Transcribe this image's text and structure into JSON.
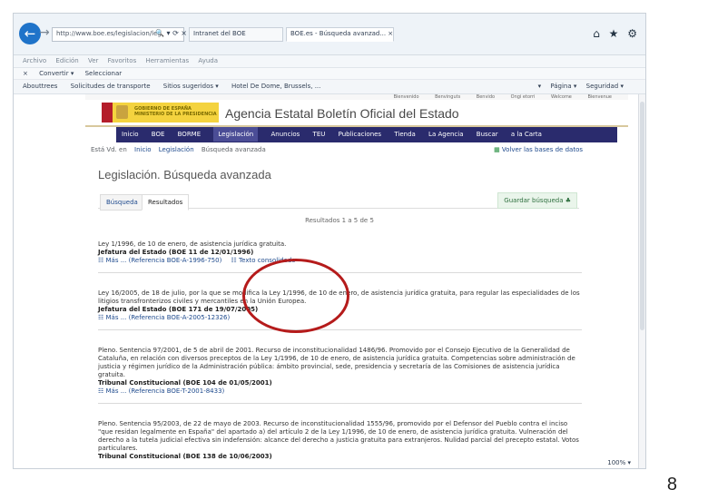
{
  "page": {
    "number": "8"
  },
  "browser": {
    "address": "http://www.boe.es/legislacion/leg",
    "address_icons": "🔍 ▾ ⟳ ×",
    "tabs": [
      {
        "label": "Intranet del BOE"
      },
      {
        "label": "BOE.es - Búsqueda avanzad... ×"
      }
    ],
    "menu": [
      "Archivo",
      "Edición",
      "Ver",
      "Favoritos",
      "Herramientas",
      "Ayuda"
    ],
    "command_bar": [
      "×",
      "Convertir ▾",
      "Seleccionar"
    ],
    "favorites": [
      "Abouttrees",
      "Solicitudes de transporte",
      "Sitios sugeridos ▾",
      "Hotel De Dome, Brussels, ..."
    ],
    "right_tools": [
      "▾",
      "Página ▾",
      "Seguridad ▾"
    ],
    "zoom": "100% ▾",
    "window_icons": "⌂ ★ ⚙"
  },
  "site": {
    "languages": [
      "Bienvenido",
      "Benvinguts",
      "Benvido",
      "Ongi etorri",
      "Welcome",
      "Bienvenue"
    ],
    "logo_text": "GOBIERNO DE ESPAÑA\nMINISTERIO DE LA PRESIDENCIA",
    "title": "Agencia Estatal Boletín Oficial del Estado",
    "nav": [
      "Inicio",
      "BOE",
      "BORME",
      "Legislación",
      "Anuncios",
      "TEU",
      "Publicaciones",
      "Tienda",
      "La Agencia",
      "Buscar",
      "a la Carta"
    ],
    "breadcrumb": {
      "prefix": "Está Vd. en",
      "items": [
        "Inicio",
        "Legislación",
        "Búsqueda avanzada"
      ]
    },
    "saved_data": "Volver las bases de datos",
    "page_title": "Legislación. Búsqueda avanzada",
    "tabs": [
      "Búsqueda",
      "Resultados"
    ],
    "save_search": "Guardar búsqueda ♣",
    "results_summary": "Resultados 1 a 5 de 5",
    "results": [
      {
        "title": "Ley 1/1996, de 10 de enero, de asistencia jurídica gratuita.",
        "source": "Jefatura del Estado (BOE 11 de 12/01/1996)",
        "link": "☷ Más ... (Referencia BOE-A-1996-750)",
        "extra": "☷ Texto consolidado"
      },
      {
        "title": "Ley 16/2005, de 18 de julio, por la que se modifica la Ley 1/1996, de 10 de enero, de asistencia jurídica gratuita, para regular las especialidades de los litigios transfronterizos civiles y mercantiles en la Unión Europea.",
        "source": "Jefatura del Estado (BOE 171 de 19/07/2005)",
        "link": "☷ Más ... (Referencia BOE-A-2005-12326)"
      },
      {
        "title": "Pleno. Sentencia 97/2001, de 5 de abril de 2001. Recurso de inconstitucionalidad 1486/96. Promovido por el Consejo Ejecutivo de la Generalidad de Cataluña, en relación con diversos preceptos de la Ley 1/1996, de 10 de enero, de asistencia jurídica gratuita. Competencias sobre administración de justicia y régimen jurídico de la Administración pública: ámbito provincial, sede, presidencia y secretaría de las Comisiones de asistencia jurídica gratuita.",
        "source": "Tribunal Constitucional (BOE 104 de 01/05/2001)",
        "link": "☷ Más ... (Referencia BOE-T-2001-8433)"
      },
      {
        "title": "Pleno. Sentencia 95/2003, de 22 de mayo de 2003. Recurso de inconstitucionalidad 1555/96, promovido por el Defensor del Pueblo contra el inciso \"que residan legalmente en España\" del apartado a) del artículo 2 de la Ley 1/1996, de 10 de enero, de asistencia jurídica gratuita. Vulneración del derecho a la tutela judicial efectiva sin indefensión: alcance del derecho a justicia gratuita para extranjeros. Nulidad parcial del precepto estatal. Votos particulares.",
        "source": "Tribunal Constitucional (BOE 138 de 10/06/2003)"
      }
    ]
  }
}
